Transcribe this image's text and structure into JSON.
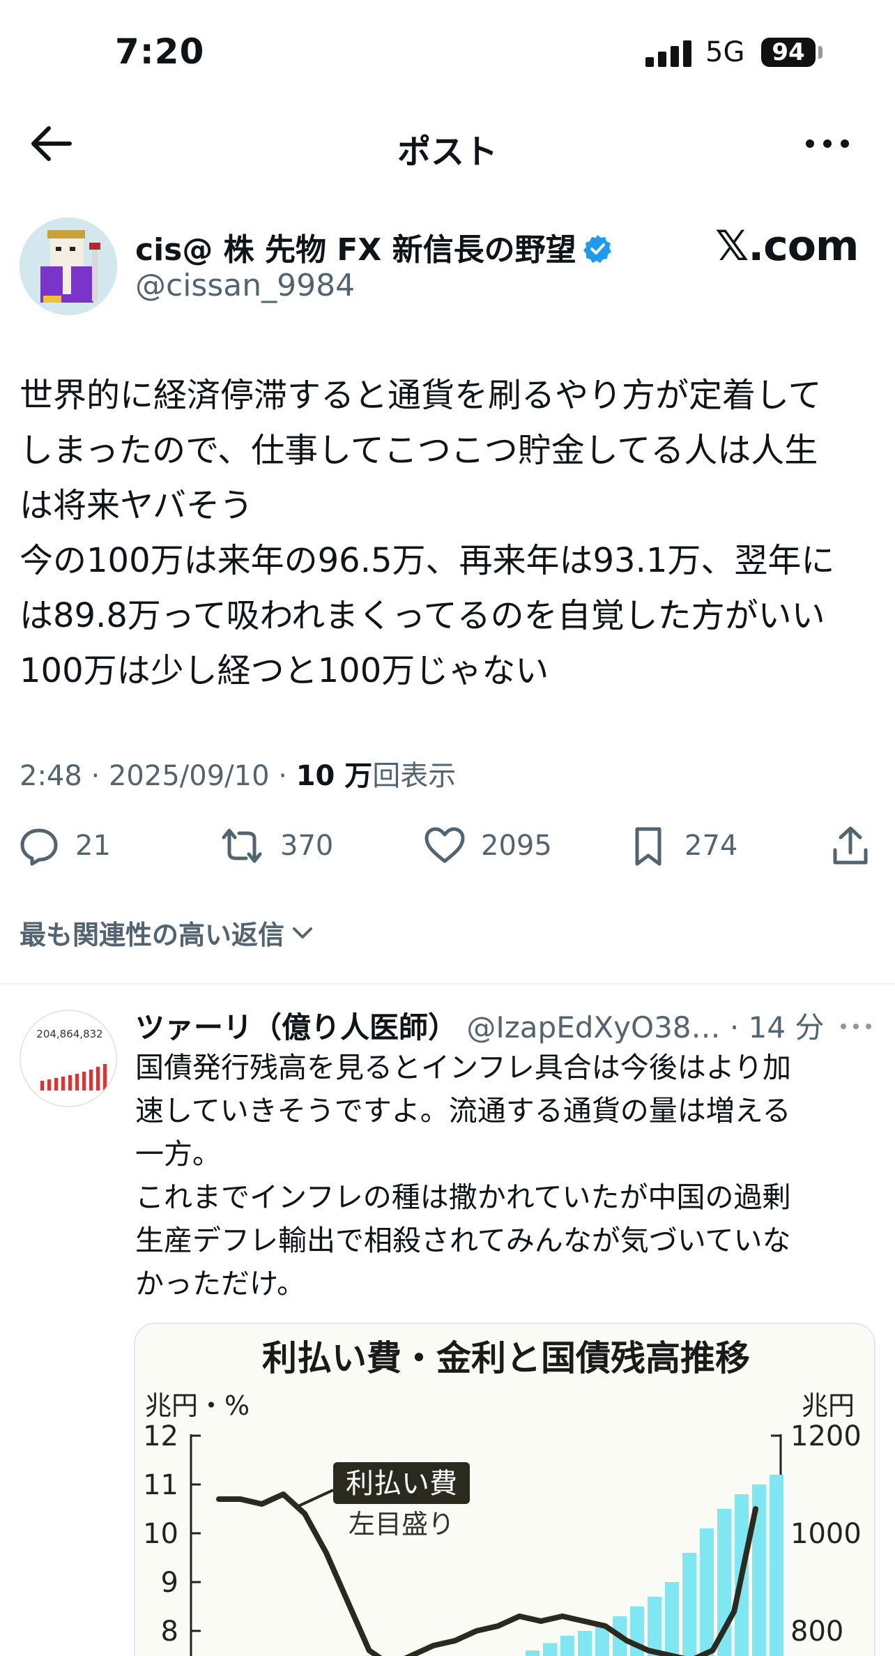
{
  "status_bar": {
    "time": "7:20",
    "network": "5G",
    "battery": "94"
  },
  "nav": {
    "title": "ポスト",
    "back_icon": "arrow-left-icon",
    "more_icon": "more-horizontal-icon"
  },
  "post": {
    "author_name": "cis@ 株 先物 FX 新信長の野望",
    "author_handle": "@cissan_9984",
    "source_badge": "𝕏.com",
    "text": "世界的に経済停滞すると通貨を刷るやり方が定着して\nしまったので、仕事してこつこつ貯金してる人は人生\nは将来ヤバそう\n今の100万は来年の96.5万、再来年は93.1万、翌年に\nは89.8万って吸われまくってるのを自覚した方がいい\n100万は少し経つと100万じゃない",
    "time": "2:48",
    "separator": "·",
    "date": "2025/09/10",
    "views_count": "10 万",
    "views_label": "回表示",
    "replies": "21",
    "reposts": "370",
    "likes": "2095",
    "bookmarks": "274"
  },
  "reply_sort": {
    "label": "最も関連性の高い返信"
  },
  "reply": {
    "name": "ツァーリ（億り人医師）",
    "handle": "@IzapEdXyO38…",
    "time": "· 14 分",
    "avatar_text": "204,864,832",
    "text": "国債発行残高を見るとインフレ具合は今後はより加\n速していきそうですよ。流通する通貨の量は増える\n一方。\nこれまでインフレの種は撒かれていたが中国の過剰\n生産デフレ輸出で相殺されてみんなが気づいていな\nかっただけ。"
  },
  "chart_data": {
    "type": "bar",
    "title": "利払い費・金利と国債残高推移",
    "left_unit": "兆円・%",
    "right_unit": "兆円",
    "left_ticks": [
      "12",
      "11",
      "10",
      "9",
      "8"
    ],
    "right_ticks": [
      "1200",
      "1000",
      "800"
    ],
    "annotation_label": "利払い費",
    "annotation_sub": "左目盛り",
    "ylim_left": [
      7.4,
      12
    ],
    "ylim_right": [
      800,
      1200
    ],
    "line_series": {
      "name": "利払い費",
      "values": [
        10.7,
        10.7,
        10.6,
        10.8,
        10.4,
        9.6,
        8.6,
        7.6,
        7.3,
        7.5,
        7.7,
        7.8,
        8.0,
        8.1,
        8.3,
        8.2,
        8.3,
        8.2,
        8.1,
        7.8,
        7.6,
        7.5,
        7.4,
        7.6,
        8.4,
        10.5
      ]
    },
    "bar_series": {
      "values": [
        760,
        775,
        790,
        800,
        810,
        830,
        850,
        870,
        900,
        960,
        1010,
        1050,
        1080,
        1100,
        1120
      ]
    }
  }
}
